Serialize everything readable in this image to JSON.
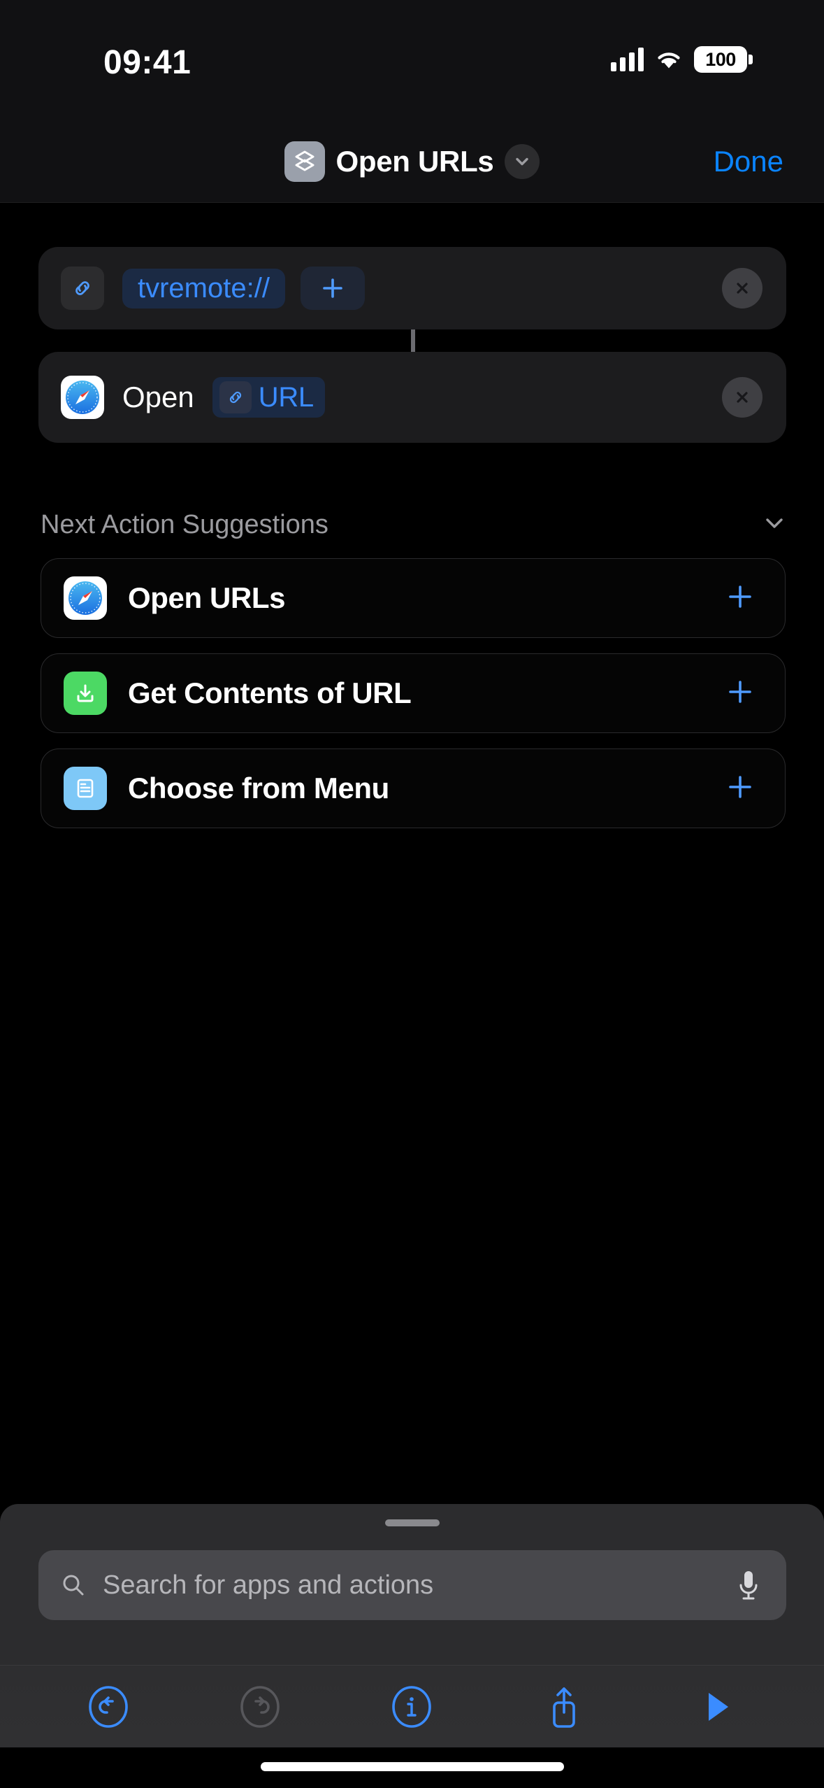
{
  "status_bar": {
    "time": "09:41",
    "cellular_icon": "signal-bars-icon",
    "wifi_icon": "wifi-icon",
    "battery_level": "100"
  },
  "nav_bar": {
    "shortcut_icon": "stacked-layers-icon",
    "title": "Open URLs",
    "chevron_icon": "chevron-down-icon",
    "done_label": "Done",
    "done_color": "#0A84FF"
  },
  "actions": [
    {
      "id": "url-action",
      "leading_icon": "link-chain-icon",
      "token_text": "tvremote://",
      "add_label": "+",
      "delete_icon": "close-x-icon"
    },
    {
      "id": "open-action",
      "app_icon": "safari-compass-icon",
      "verb": "Open",
      "token_icon": "link-chain-icon",
      "token_text": "URL",
      "delete_icon": "close-x-icon"
    }
  ],
  "suggestions": {
    "header": "Next Action Suggestions",
    "collapse_icon": "chevron-down-icon",
    "items": [
      {
        "icon": "safari-compass-icon",
        "label": "Open URLs",
        "add_icon": "plus-icon"
      },
      {
        "icon": "get-contents-download-icon",
        "label": "Get Contents of URL",
        "add_icon": "plus-icon"
      },
      {
        "icon": "choose-from-menu-list-icon",
        "label": "Choose from Menu",
        "add_icon": "plus-icon"
      }
    ]
  },
  "search": {
    "icon": "search-magnifier-icon",
    "placeholder": "Search for apps and actions",
    "value": "",
    "mic_icon": "microphone-icon"
  },
  "toolbar": {
    "buttons": [
      {
        "name": "undo-button",
        "icon": "undo-arrow-icon",
        "enabled": true
      },
      {
        "name": "redo-button",
        "icon": "redo-arrow-icon",
        "enabled": false
      },
      {
        "name": "info-button",
        "icon": "info-circle-icon",
        "enabled": true
      },
      {
        "name": "share-button",
        "icon": "share-up-arrow-icon",
        "enabled": true
      },
      {
        "name": "run-button",
        "icon": "play-triangle-icon",
        "enabled": true
      }
    ]
  },
  "colors": {
    "accent_blue": "#0A84FF",
    "token_blue": "#3B8CFF",
    "card_bg": "#1C1C1E",
    "secondary_text": "#9B9B9F",
    "green_icon": "#4CD964",
    "lightblue_icon": "#7EC8F7"
  }
}
